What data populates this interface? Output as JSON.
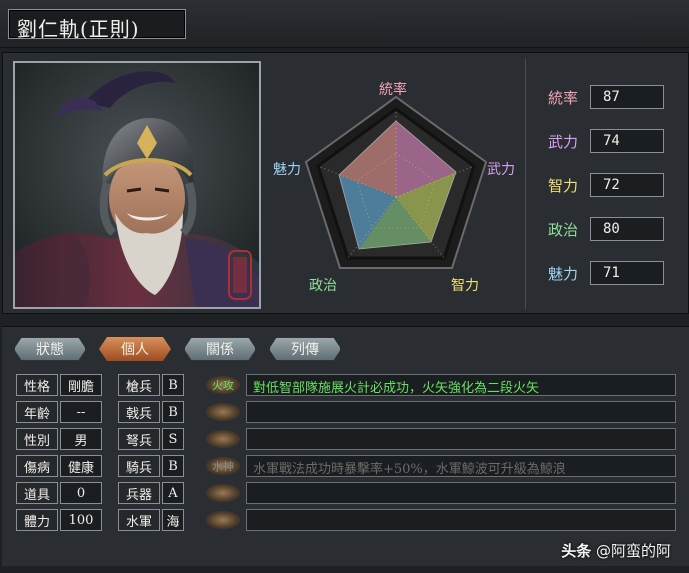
{
  "general": {
    "name": "劉仁軌(正則)"
  },
  "radar": {
    "labels": {
      "command": "統率",
      "war": "武力",
      "int": "智力",
      "pol": "政治",
      "charm": "魅力"
    },
    "colors": {
      "command": "#f3a4b6",
      "war": "#d6a0f0",
      "int": "#f0e070",
      "pol": "#8fe09a",
      "charm": "#9ad4f0"
    }
  },
  "stats": [
    {
      "label": "統率",
      "value": "87",
      "color": "#f3a4b6"
    },
    {
      "label": "武力",
      "value": "74",
      "color": "#d6a0f0"
    },
    {
      "label": "智力",
      "value": "72",
      "color": "#f0e070"
    },
    {
      "label": "政治",
      "value": "80",
      "color": "#8fe09a"
    },
    {
      "label": "魅力",
      "value": "71",
      "color": "#9ad4f0"
    }
  ],
  "tabs": [
    {
      "label": "狀態",
      "active": false
    },
    {
      "label": "個人",
      "active": true
    },
    {
      "label": "關係",
      "active": false
    },
    {
      "label": "列傳",
      "active": false
    }
  ],
  "personal": [
    {
      "label": "性格",
      "value": "剛膽"
    },
    {
      "label": "年齡",
      "value": "--"
    },
    {
      "label": "性別",
      "value": "男"
    },
    {
      "label": "傷病",
      "value": "健康"
    },
    {
      "label": "道具",
      "value": "0"
    },
    {
      "label": "體力",
      "value": "100"
    }
  ],
  "aptitudes": [
    {
      "label": "槍兵",
      "value": "B"
    },
    {
      "label": "戟兵",
      "value": "B"
    },
    {
      "label": "弩兵",
      "value": "S"
    },
    {
      "label": "騎兵",
      "value": "B"
    },
    {
      "label": "兵器",
      "value": "A"
    },
    {
      "label": "水軍",
      "value": "海"
    }
  ],
  "skills": [
    {
      "icon": "火攻",
      "text": "對低智部隊施展火計必成功，火矢強化為二段火矢",
      "color": "#66e060"
    },
    {
      "icon": "",
      "text": "",
      "color": "#cccccc"
    },
    {
      "icon": "",
      "text": "",
      "color": "#cccccc"
    },
    {
      "icon": "水神",
      "text": "水軍戰法成功時暴擊率+50%，水軍鯨波可升級為鯨浪",
      "color": "#6a6a6a"
    },
    {
      "icon": "",
      "text": "",
      "color": "#cccccc"
    },
    {
      "icon": "",
      "text": "",
      "color": "#cccccc"
    }
  ],
  "watermark": {
    "brand": "头条",
    "handle": "@阿蛮的阿"
  }
}
